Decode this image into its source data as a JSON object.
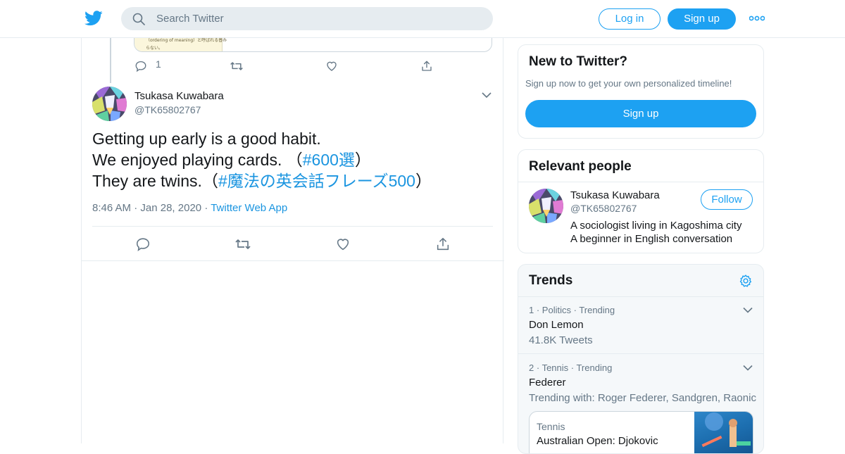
{
  "header": {
    "search_placeholder": "Search Twitter",
    "login_label": "Log in",
    "signup_label": "Sign up",
    "brand_color": "#1da1f2"
  },
  "prev_tweet": {
    "media_lines": [
      "（ordering of meaning）と呼ばれる普み",
      "らない。"
    ],
    "reply_count": "1"
  },
  "tweet": {
    "display_name": "Tsukasa Kuwabara",
    "handle": "@TK65802767",
    "text_lines": [
      {
        "text": "Getting up early is a good habit.",
        "hashtag": "",
        "suffix": ""
      },
      {
        "text": "We enjoyed playing cards. （",
        "hashtag": "#600選",
        "suffix": "）"
      },
      {
        "text": "They are twins.（",
        "hashtag": "#魔法の英会話フレーズ500",
        "suffix": "）"
      }
    ],
    "time": "8:46 AM",
    "date": "Jan 28, 2020",
    "source": "Twitter Web App"
  },
  "sidebar": {
    "new_to_twitter": {
      "title": "New to Twitter?",
      "subtitle": "Sign up now to get your own personalized timeline!",
      "button": "Sign up"
    },
    "relevant_people": {
      "title": "Relevant people",
      "name": "Tsukasa Kuwabara",
      "handle": "@TK65802767",
      "follow_label": "Follow",
      "bio_lines": [
        "A sociologist living in Kagoshima city",
        "A beginner in English conversation"
      ]
    },
    "trends": {
      "title": "Trends",
      "items": [
        {
          "rank": "1",
          "category": "Politics",
          "status": "Trending",
          "name": "Don Lemon",
          "detail": "41.8K Tweets"
        },
        {
          "rank": "2",
          "category": "Tennis",
          "status": "Trending",
          "name": "Federer",
          "detail": "Trending with: Roger Federer, Sandgren, Raonic"
        }
      ],
      "news": {
        "category": "Tennis",
        "headline": "Australian Open: Djokovic"
      }
    }
  }
}
